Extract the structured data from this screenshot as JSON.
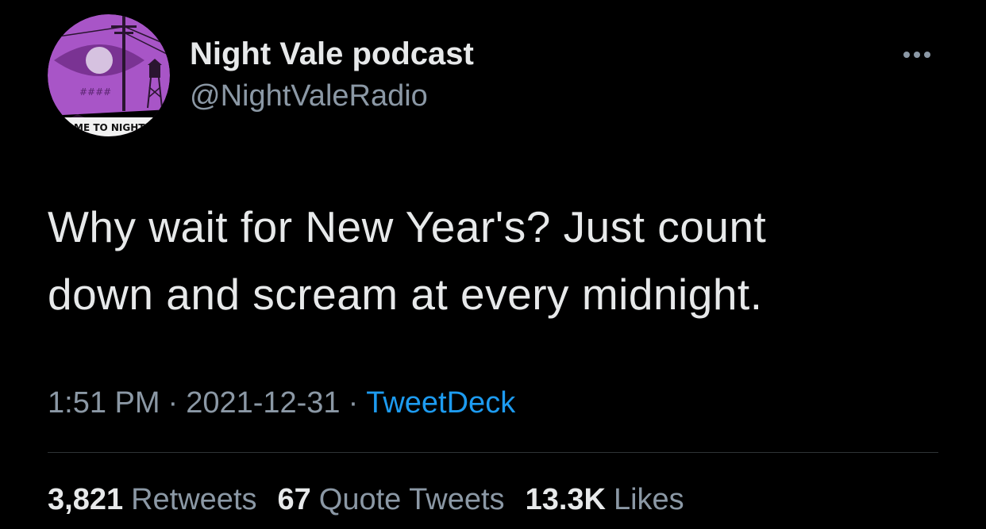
{
  "tweet": {
    "author": {
      "display_name": "Night Vale podcast",
      "handle": "@NightValeRadio",
      "avatar": {
        "banner_text": "COME TO NIGHT V",
        "background_color": "#a855c7",
        "icon": "moon-eye-radio-tower-logo"
      }
    },
    "text_lines": [
      "Why wait for New Year's? Just count",
      "down and scream at every midnight."
    ],
    "time": "1:51 PM",
    "date": "2021-12-31",
    "separator": "·",
    "source": "TweetDeck",
    "stats": {
      "retweets": {
        "count": "3,821",
        "label": "Retweets"
      },
      "quote_tweets": {
        "count": "67",
        "label": "Quote Tweets"
      },
      "likes": {
        "count": "13.3K",
        "label": "Likes"
      }
    },
    "more_icon": "more-horizontal-icon"
  },
  "colors": {
    "background": "#000000",
    "primary_text": "#e7e9ea",
    "secondary_text": "#8b98a5",
    "link": "#1d9bf0",
    "divider": "#2f3336"
  }
}
